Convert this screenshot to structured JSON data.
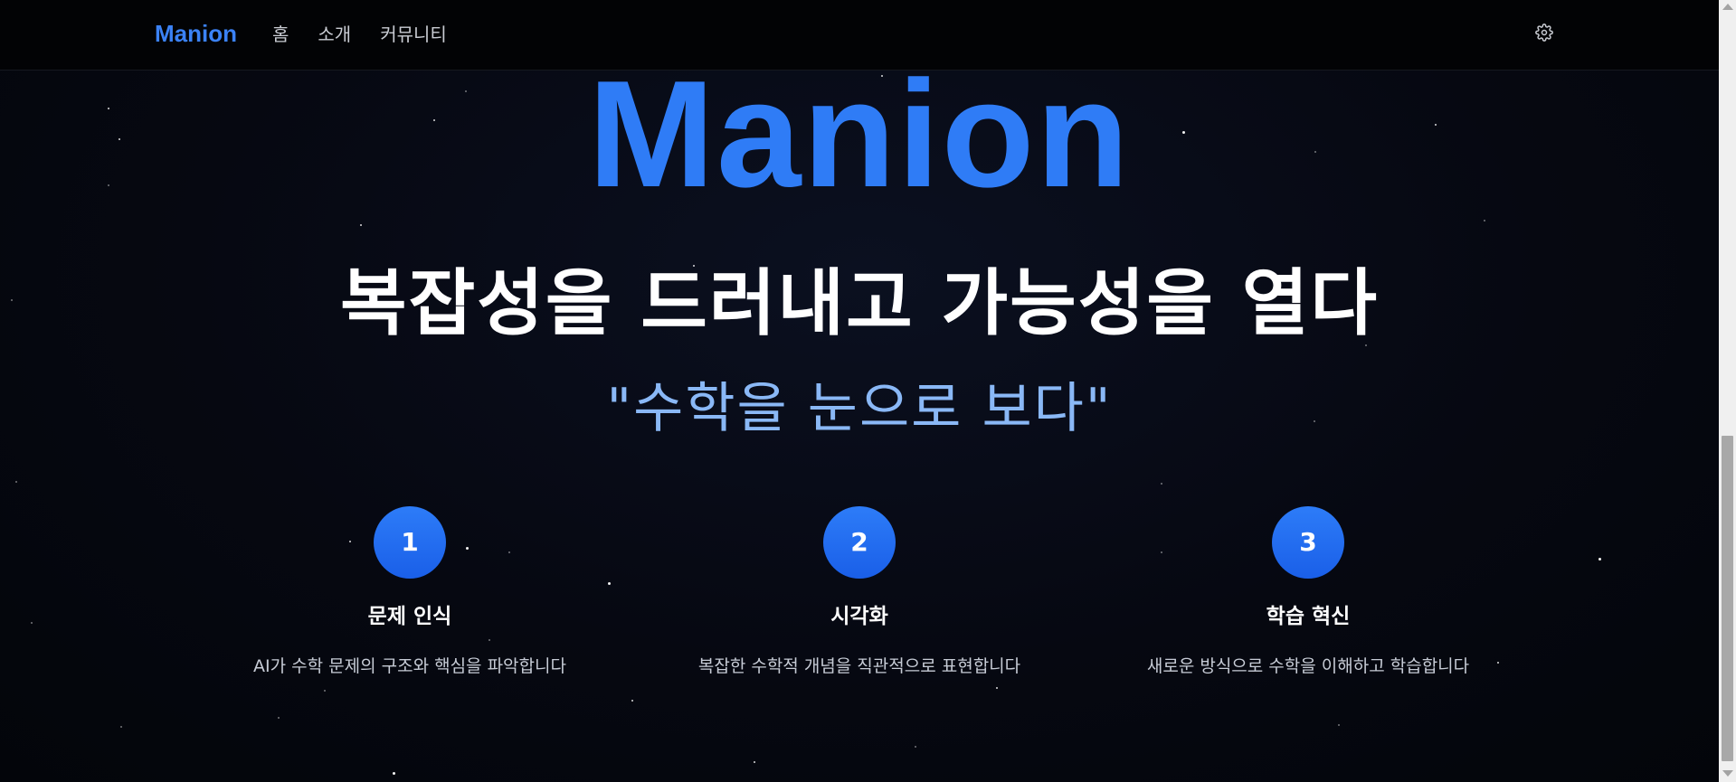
{
  "nav": {
    "brand": "Manion",
    "links": [
      "홈",
      "소개",
      "커뮤니티"
    ],
    "settings_icon": "gear-icon"
  },
  "hero": {
    "title": "Manion",
    "headline": "복잡성을 드러내고 가능성을 열다",
    "quote": "\"수학을 눈으로 보다\""
  },
  "steps": [
    {
      "number": "1",
      "title": "문제 인식",
      "description": "AI가 수학 문제의 구조와 핵심을 파악합니다"
    },
    {
      "number": "2",
      "title": "시각화",
      "description": "복잡한 수학적 개념을 직관적으로 표현합니다"
    },
    {
      "number": "3",
      "title": "학습 혁신",
      "description": "새로운 방식으로 수학을 이해하고 학습합니다"
    }
  ],
  "colors": {
    "accent": "#2f7cf6",
    "quote": "#8ab8f6",
    "background": "#05070c"
  }
}
